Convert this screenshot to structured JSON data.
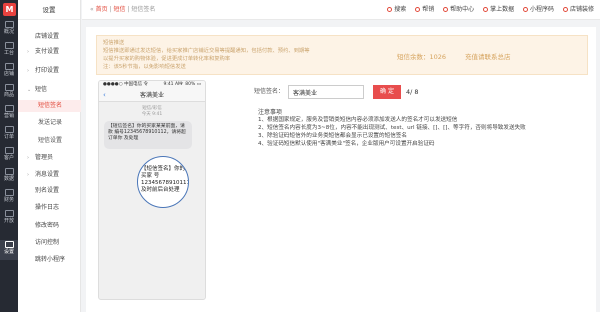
{
  "rail": {
    "logo": "M",
    "items": [
      {
        "label": "概况"
      },
      {
        "label": "工台"
      },
      {
        "label": "店铺"
      },
      {
        "label": "商品"
      },
      {
        "label": "营销"
      },
      {
        "label": "订单"
      },
      {
        "label": "客户"
      },
      {
        "label": "数据"
      },
      {
        "label": "财务"
      },
      {
        "label": "开放"
      },
      {
        "label": "设置"
      }
    ]
  },
  "menu": {
    "title": "设置",
    "items": [
      {
        "label": "店铺设置",
        "caret": ""
      },
      {
        "label": "支付设置",
        "caret": "›"
      },
      {
        "label": "打印设置",
        "caret": "›"
      },
      {
        "label": "短信",
        "caret": "⌄"
      },
      {
        "label": "短信签名",
        "caret": ""
      },
      {
        "label": "发送记录",
        "caret": ""
      },
      {
        "label": "短信设置",
        "caret": ""
      },
      {
        "label": "管理员",
        "caret": "›"
      },
      {
        "label": "消息设置",
        "caret": "›"
      },
      {
        "label": "别名设置",
        "caret": ""
      },
      {
        "label": "操作日志",
        "caret": ""
      },
      {
        "label": "修改密码",
        "caret": ""
      },
      {
        "label": "访问控制",
        "caret": ""
      },
      {
        "label": "跳转小程序",
        "caret": ""
      }
    ]
  },
  "topbar": {
    "nav": "«",
    "home": "首页",
    "sep1": "|",
    "section": "短信",
    "sep2": "|",
    "page": "短信签名",
    "tools": [
      "搜索",
      "帮销",
      "帮助中心",
      "掌上数据",
      "小程序码",
      "店铺装修"
    ]
  },
  "notice": {
    "line1": "短信推送",
    "line2": "短信推送即通过发达短信，给买家推广店铺近交易等提醒通知，包括付款、预约、到期等",
    "line3": "以提升买家的购物体验，促进更成订单转化率和复购率",
    "line4": "注：该5秒节指，以免影响短信发送",
    "balance": "短信余数：1026",
    "recharge": "充值请联系总店"
  },
  "phone": {
    "status_left": "●●●●○ 中国电信 令",
    "status_time": "9:41 AM",
    "status_right": "✓ 80% ▭",
    "back": "‹",
    "title": "客满美业",
    "info1": "短信/彩信",
    "info2": "今天 9:41",
    "bubble": "【短信签名】你的买家某某前面，请款 编号12345678910112，请将超订单你 及处理",
    "zoom": "【短信签名】你的买家 号12345678910111 及时前后台处理"
  },
  "form": {
    "sign_label": "短信签名：",
    "sign_value": "客满美业",
    "confirm": "确 定",
    "count": "4/ 8"
  },
  "rules": {
    "title": "注意事项",
    "items": [
      "1、根据国家规定，服务及营销类短信内容必须添加发送人的签名才可以发送短信",
      "2、短信签名内容长度为3~8位，内容不能出现测试、test、url 链接、[]、[]、等字符，否则将导致发送失败",
      "3、除验证码短信外的业务类短信都会显示已设置的短信签名",
      "4、验证码短信默认使用\"客满美业\"签名，企业版用户可设置开启验证码"
    ]
  }
}
